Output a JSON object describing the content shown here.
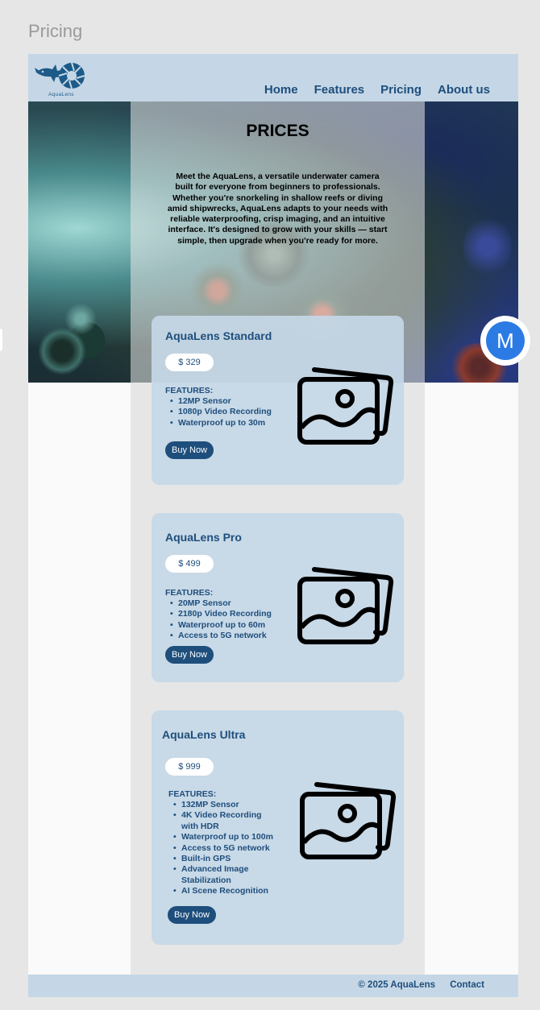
{
  "frame": {
    "label": "Pricing"
  },
  "brand": {
    "name": "AquaLens",
    "colors": {
      "primary": "#1e4e7c",
      "panel": "#c5d7e6",
      "avatar": "#2c7be5"
    }
  },
  "nav": {
    "items": [
      {
        "label": "Home"
      },
      {
        "label": "Features"
      },
      {
        "label": "Pricing"
      },
      {
        "label": "About us"
      }
    ]
  },
  "hero": {
    "title": "PRICES",
    "text": "Meet the AquaLens, a versatile underwater camera built for everyone from beginners to professionals. Whether you're snorkeling in shallow reefs or diving amid shipwrecks, AquaLens adapts to your needs with reliable waterproofing, crisp imaging, and an intuitive interface. It's designed to grow with your skills — start simple, then upgrade when you're ready for more."
  },
  "products": [
    {
      "title": "AquaLens Standard",
      "price": "$ 329",
      "features_label": "FEATURES:",
      "features": [
        "12MP Sensor",
        "1080p Video Recording",
        "Waterproof up to 30m"
      ],
      "buy_label": "Buy Now",
      "icon": "image-icon"
    },
    {
      "title": "AquaLens Pro",
      "price": "$ 499",
      "features_label": "FEATURES:",
      "features": [
        "20MP Sensor",
        "2180p Video Recording",
        "Waterproof up to 60m",
        "Access to 5G network"
      ],
      "buy_label": "Buy Now",
      "icon": "image-icon"
    },
    {
      "title": "AquaLens Ultra",
      "price": "$ 999",
      "features_label": "FEATURES:",
      "features": [
        "132MP Sensor",
        "4K Video Recording with HDR",
        "Waterproof up to 100m",
        "Access to 5G network",
        "Built-in GPS",
        "Advanced Image Stabilization",
        "AI Scene Recognition"
      ],
      "buy_label": "Buy Now",
      "icon": "image-icon"
    }
  ],
  "footer": {
    "copyright": "© 2025 AquaLens",
    "contact": "Contact"
  },
  "avatar": {
    "initial": "M"
  }
}
